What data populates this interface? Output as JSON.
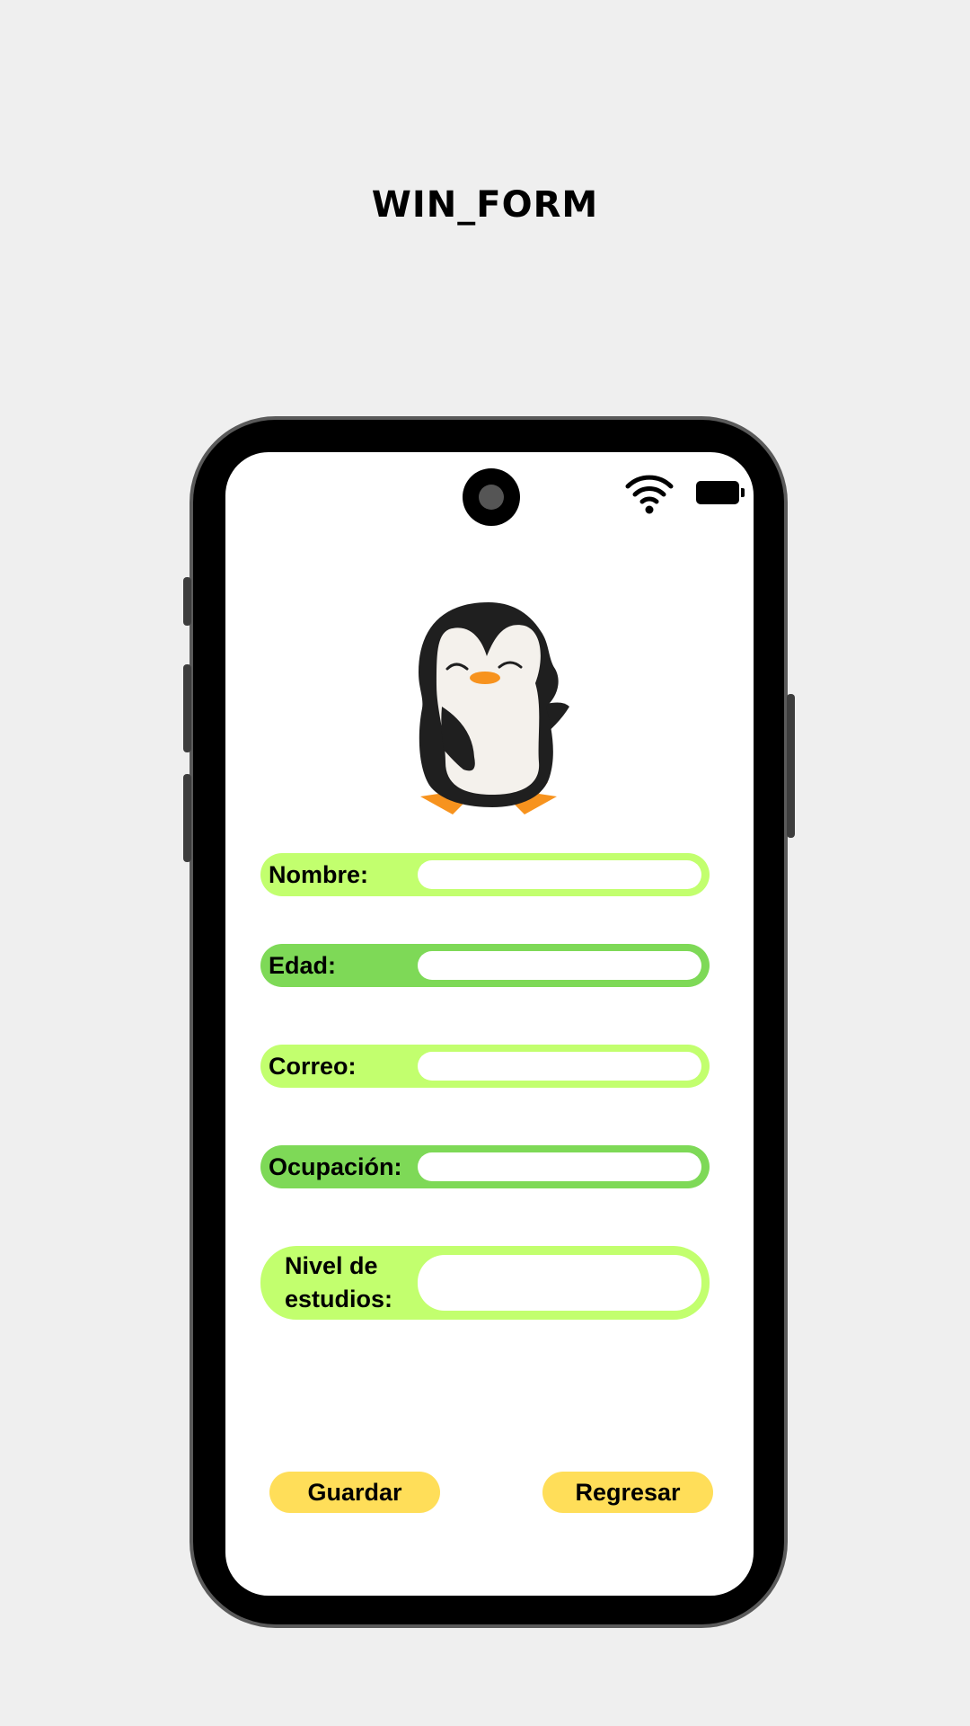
{
  "page": {
    "title": "WIN_FORM"
  },
  "status_bar": {
    "wifi_icon": "wifi-icon",
    "battery_icon": "battery-icon"
  },
  "illustration": {
    "icon": "penguin-icon"
  },
  "form": {
    "fields": [
      {
        "label": "Nombre:",
        "value": "",
        "placeholder": ""
      },
      {
        "label": "Edad:",
        "value": "",
        "placeholder": ""
      },
      {
        "label": "Correo:",
        "value": "",
        "placeholder": ""
      },
      {
        "label": "Ocupación:",
        "value": "",
        "placeholder": ""
      },
      {
        "label": "Nivel de estudios:",
        "value": "",
        "placeholder": ""
      }
    ]
  },
  "actions": {
    "save_label": "Guardar",
    "back_label": "Regresar"
  },
  "colors": {
    "field_light": "#c2ff6e",
    "field_dark": "#7ed957",
    "button": "#ffde59",
    "background": "#efefef"
  }
}
